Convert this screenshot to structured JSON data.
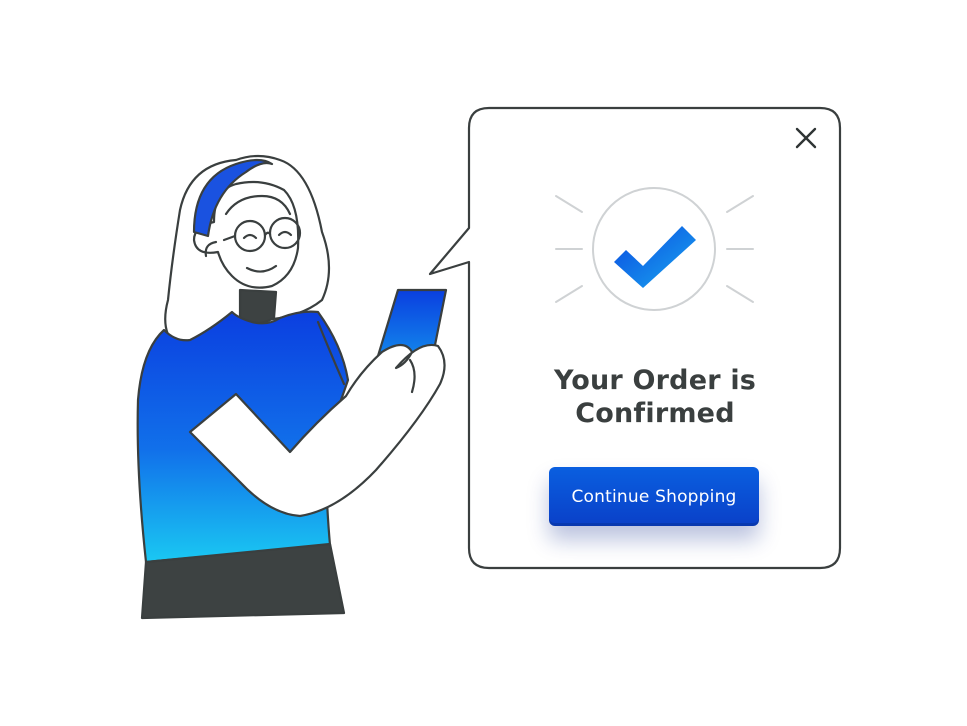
{
  "dialog": {
    "title_line1": "Your Order is",
    "title_line2": "Confirmed",
    "continue_label": "Continue Shopping",
    "close_icon": "close-icon",
    "status_icon": "checkmark-icon"
  },
  "colors": {
    "accent": "#0a4fd8",
    "accent_light": "#1ab8f0",
    "outline": "#3a3f3f",
    "skirt": "#3d4242"
  }
}
